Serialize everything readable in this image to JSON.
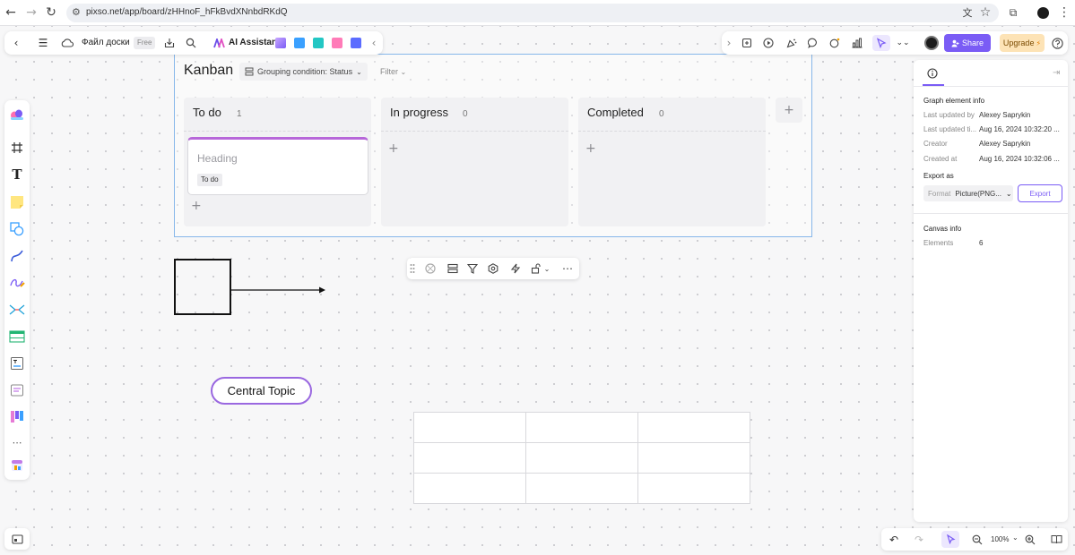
{
  "browser": {
    "url": "pixso.net/app/board/zHHnoF_hFkBvdXNnbdRKdQ"
  },
  "toolbar": {
    "file_name": "Файл доски",
    "plan_badge": "Free",
    "ai_label": "AI Assistant",
    "share_label": "Share",
    "upgrade_label": "Upgrade"
  },
  "kanban": {
    "title": "Kanban",
    "grouping": "Grouping condition: Status",
    "filter": "Filter",
    "columns": [
      {
        "name": "To do",
        "count": "1"
      },
      {
        "name": "In progress",
        "count": "0"
      },
      {
        "name": "Completed",
        "count": "0"
      }
    ],
    "card": {
      "heading": "Heading",
      "status": "To do"
    }
  },
  "mindmap": {
    "central_topic": "Central Topic"
  },
  "panel": {
    "section_title": "Graph element info",
    "fields": [
      {
        "key": "Last updated by",
        "value": "Alexey Saprykin"
      },
      {
        "key": "Last updated ti...",
        "value": "Aug 16, 2024 10:32:20 ..."
      },
      {
        "key": "Creator",
        "value": "Alexey Saprykin"
      },
      {
        "key": "Created at",
        "value": "Aug 16, 2024 10:32:06 ..."
      }
    ],
    "export_title": "Export as",
    "format_label": "Format",
    "format_value": "Picture(PNG...",
    "export_button": "Export",
    "canvas_title": "Canvas info",
    "elements_label": "Elements",
    "elements_value": "6"
  },
  "bottom": {
    "zoom": "100%"
  },
  "colors": {
    "accent": "#7a5cf5",
    "card_top": "#b767d9",
    "topic_border": "#9a68e0",
    "selection": "#87b7ea"
  }
}
